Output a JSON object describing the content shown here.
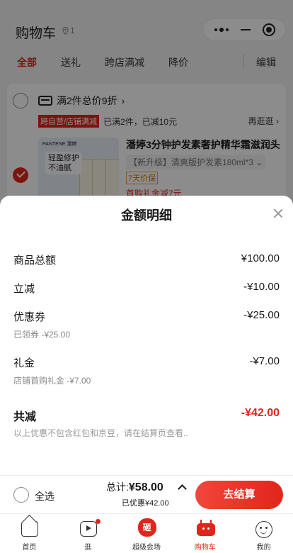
{
  "header": {
    "title": "购物车",
    "count": "1"
  },
  "tabs": [
    {
      "label": "全部",
      "active": true
    },
    {
      "label": "送礼",
      "active": false
    },
    {
      "label": "跨店满减",
      "active": false
    },
    {
      "label": "降价",
      "active": false
    }
  ],
  "edit_label": "编辑",
  "store": {
    "promo_text": "满2件总价9折",
    "promo_arrow": "›",
    "tag": "跨自营/店铺满减",
    "tag_status": "已满2件，已减10元",
    "more_link": "再逛逛 ›"
  },
  "product": {
    "brand": "PANTENE 潘婷",
    "slogan_line1": "轻盈修护",
    "slogan_line2": "不油腻",
    "name": "潘婷3分钟护发素奢护精华霜滋润头",
    "spec": "【新升级】清爽版护发素180ml*3 ⌄",
    "price_guarantee": "7天价保",
    "gift_text": "首购礼金减7元"
  },
  "sheet": {
    "title": "金额明细",
    "rows": [
      {
        "label": "商品总额",
        "amount": "¥100.00"
      },
      {
        "label": "立减",
        "amount": "-¥10.00"
      },
      {
        "label": "优惠券",
        "amount": "-¥25.00",
        "sub": "已领券 -¥25.00"
      },
      {
        "label": "礼金",
        "amount": "-¥7.00",
        "sub": "店铺首购礼金 -¥7.00"
      }
    ],
    "total": {
      "label": "共减",
      "amount": "-¥42.00"
    },
    "note": "以上优惠不包含红包和京豆，请在结算页查看.."
  },
  "bottom": {
    "select_all": "全选",
    "sum_label": "总计:",
    "sum_amount": "¥58.00",
    "saved": "已优惠¥42.00",
    "checkout": "去结算"
  },
  "tabbar": [
    {
      "label": "首页",
      "icon": "home-icon"
    },
    {
      "label": "逛",
      "icon": "video-icon"
    },
    {
      "label": "超级会场",
      "icon": "venue-icon",
      "icon_text": "砸"
    },
    {
      "label": "购物车",
      "icon": "cart-icon",
      "active": true
    },
    {
      "label": "我的",
      "icon": "profile-icon"
    }
  ],
  "colors": {
    "accent": "#e1251b",
    "mask": "rgba(0,0,0,0.45)"
  }
}
